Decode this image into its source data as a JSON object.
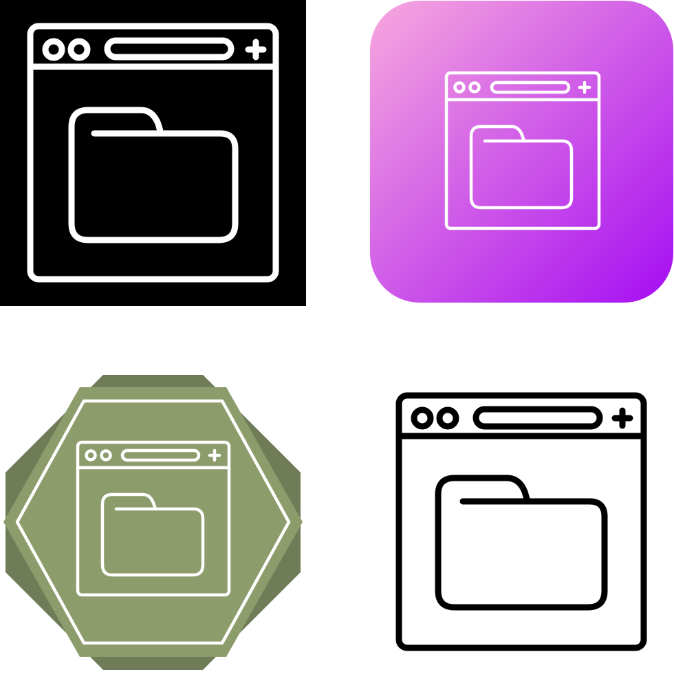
{
  "icon_set": {
    "subject": "browser-folder",
    "variants": [
      {
        "style": "glyph",
        "background": "#000000",
        "stroke": "#ffffff"
      },
      {
        "style": "gradient",
        "gradient_start": "#f8a8de",
        "gradient_end": "#a50df2",
        "stroke": "#ffffff"
      },
      {
        "style": "badge",
        "badge_outer": "#6f7c57",
        "badge_inner": "#8c9c6b",
        "stroke": "#ffffff"
      },
      {
        "style": "line",
        "background": "#ffffff",
        "stroke": "#000000"
      }
    ]
  }
}
